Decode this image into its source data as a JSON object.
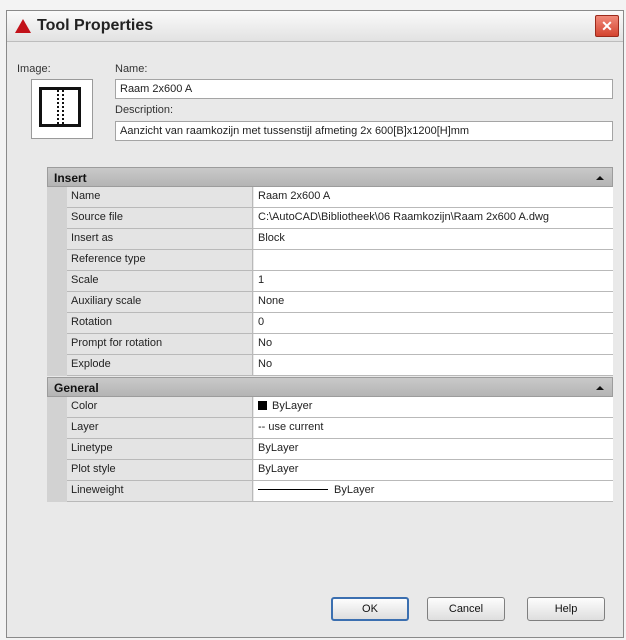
{
  "window": {
    "title": "Tool Properties",
    "close_glyph": "✕"
  },
  "image_label": "Image:",
  "name_label": "Name:",
  "name_value": "Raam 2x600 A",
  "description_label": "Description:",
  "description_value": "Aanzicht van raamkozijn met tussenstijl afmeting 2x 600[B]x1200[H]mm",
  "insert": {
    "header": "Insert",
    "rows": [
      {
        "key": "Name",
        "value": "Raam 2x600 A"
      },
      {
        "key": "Source file",
        "value": "C:\\AutoCAD\\Bibliotheek\\06 Raamkozijn\\Raam 2x600 A.dwg"
      },
      {
        "key": "Insert as",
        "value": "Block"
      },
      {
        "key": "Reference type",
        "value": ""
      },
      {
        "key": "Scale",
        "value": "1"
      },
      {
        "key": "Auxiliary scale",
        "value": "None"
      },
      {
        "key": "Rotation",
        "value": "0"
      },
      {
        "key": "Prompt for rotation",
        "value": "No"
      },
      {
        "key": "Explode",
        "value": "No"
      }
    ]
  },
  "general": {
    "header": "General",
    "rows": [
      {
        "key": "Color",
        "value": "ByLayer"
      },
      {
        "key": "Layer",
        "value": "-- use current"
      },
      {
        "key": "Linetype",
        "value": "ByLayer"
      },
      {
        "key": "Plot style",
        "value": "ByLayer"
      },
      {
        "key": "Lineweight",
        "value": "ByLayer"
      }
    ]
  },
  "buttons": {
    "ok": "OK",
    "cancel": "Cancel",
    "help": "Help"
  },
  "colors": {
    "close": "#d4432f",
    "header": "#b4b4b4",
    "ok_border": "#3b6fb0"
  }
}
